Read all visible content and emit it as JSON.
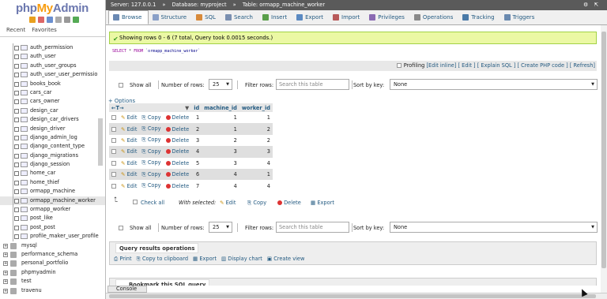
{
  "app": {
    "logo_php": "php",
    "logo_my": "My",
    "logo_admin": "Admin",
    "recent": "Recent",
    "favorites": "Favorites"
  },
  "icons": [
    "home-icon",
    "exit-icon",
    "help-icon",
    "docs-icon",
    "settings-icon",
    "reload-icon"
  ],
  "tree": {
    "tables": [
      "auth_permission",
      "auth_user",
      "auth_user_groups",
      "auth_user_user_permissio",
      "books_book",
      "cars_car",
      "cars_owner",
      "design_car",
      "design_car_drivers",
      "design_driver",
      "django_admin_log",
      "django_content_type",
      "django_migrations",
      "django_session",
      "home_car",
      "home_thief",
      "ormapp_machine",
      "ormapp_machine_worker",
      "ormapp_worker",
      "post_like",
      "post_post",
      "profile_maker_user_profile"
    ],
    "selected": "ormapp_machine_worker",
    "databases": [
      "mysql",
      "performance_schema",
      "personal_portfolio",
      "phpmyadmin",
      "test",
      "travenu"
    ]
  },
  "breadcrumb": {
    "server": "Server: 127.0.0.1",
    "database": "Database: myproject",
    "table": "Table: ormapp_machine_worker",
    "sep1": "»",
    "sep2": "»"
  },
  "tabs": [
    {
      "label": "Browse",
      "color": "#6a89b3"
    },
    {
      "label": "Structure",
      "color": "#8aa0c8"
    },
    {
      "label": "SQL",
      "color": "#d88a3a"
    },
    {
      "label": "Search",
      "color": "#7a8fb0"
    },
    {
      "label": "Insert",
      "color": "#5a9f4a"
    },
    {
      "label": "Export",
      "color": "#5b8ac2"
    },
    {
      "label": "Import",
      "color": "#b85a5a"
    },
    {
      "label": "Privileges",
      "color": "#8a6ab3"
    },
    {
      "label": "Operations",
      "color": "#8a8a8a"
    },
    {
      "label": "Tracking",
      "color": "#4a7aa8"
    },
    {
      "label": "Triggers",
      "color": "#6a8ab0"
    }
  ],
  "message": "Showing rows 0 - 6 (7 total, Query took 0.0015 seconds.)",
  "sql": {
    "select": "SELECT",
    "star": "*",
    "from": "FROM",
    "table": "`ormapp_machine_worker`"
  },
  "toolbar": {
    "profiling": "Profiling",
    "edit_inline": "[Edit inline]",
    "edit": "[ Edit ]",
    "explain": "[ Explain SQL ]",
    "php": "[ Create PHP code ]",
    "refresh": "[ Refresh]"
  },
  "nav": {
    "show_all": "Show all",
    "rows_label": "Number of rows:",
    "rows_value": "25",
    "filter_label": "Filter rows:",
    "filter_placeholder": "Search this table",
    "sort_label": "Sort by key:",
    "sort_value": "None"
  },
  "options_label": "+ Options",
  "table": {
    "columns": [
      "id",
      "machine_id",
      "worker_id"
    ],
    "actions": {
      "edit": "Edit",
      "copy": "Copy",
      "delete": "Delete"
    },
    "rows": [
      [
        1,
        1,
        1
      ],
      [
        2,
        1,
        2
      ],
      [
        3,
        2,
        2
      ],
      [
        4,
        3,
        3
      ],
      [
        5,
        3,
        4
      ],
      [
        6,
        4,
        1
      ],
      [
        7,
        4,
        4
      ]
    ]
  },
  "with_selected": {
    "check_all": "Check all",
    "label": "With selected:",
    "edit": "Edit",
    "copy": "Copy",
    "delete": "Delete",
    "export": "Export"
  },
  "query_ops": {
    "title": "Query results operations",
    "print": "Print",
    "copy_clipboard": "Copy to clipboard",
    "export": "Export",
    "display_chart": "Display chart",
    "create_view": "Create view"
  },
  "bookmark": "Bookmark this SQL query",
  "console": "Console"
}
